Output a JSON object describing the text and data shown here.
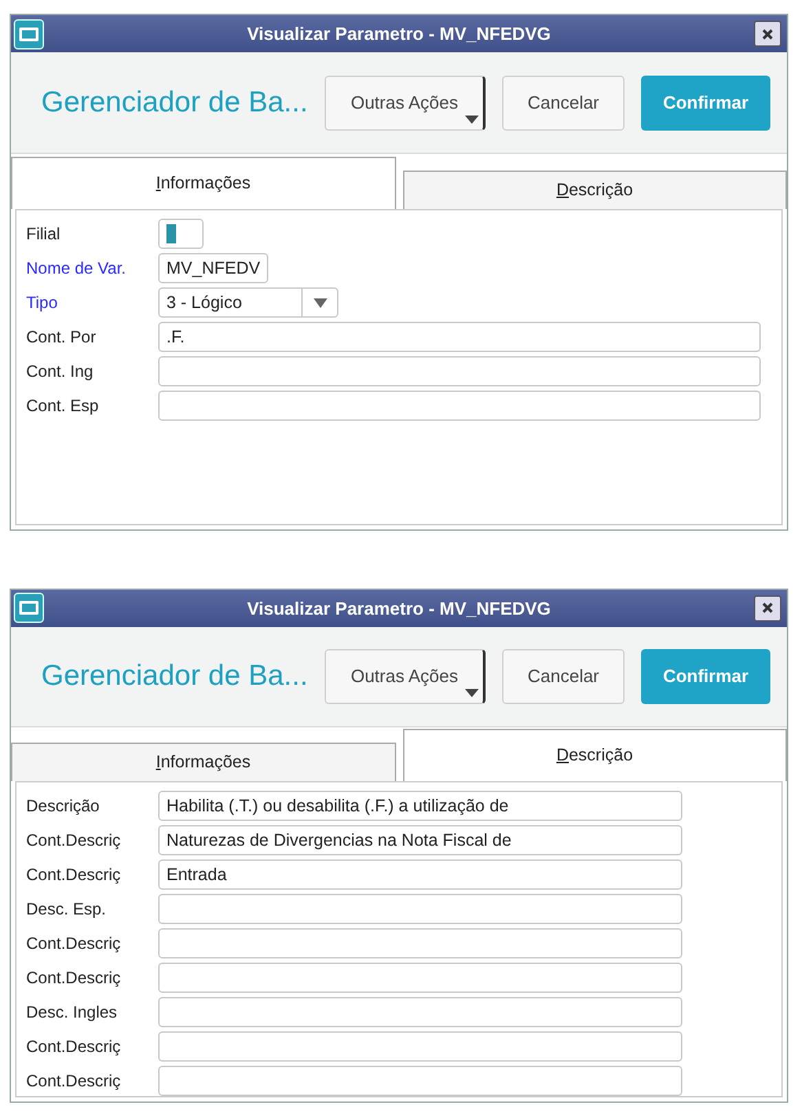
{
  "windows": [
    {
      "title": "Visualizar Parametro - MV_NFEDVG",
      "heading": "Gerenciador de Ba...",
      "buttons": [
        {
          "label": "Outras Ações",
          "kind": "menu"
        },
        {
          "label": "Cancelar",
          "kind": "default"
        },
        {
          "label": "Confirmar",
          "kind": "primary"
        }
      ],
      "tabs": [
        {
          "label": "Informações",
          "selected": true
        },
        {
          "label": "Descrição",
          "selected": false
        }
      ],
      "fields": [
        {
          "label": "Filial",
          "required": false,
          "kind": "swatch"
        },
        {
          "label": "Nome de Var.",
          "required": true,
          "kind": "short",
          "value": "MV_NFEDV"
        },
        {
          "label": "Tipo",
          "required": true,
          "kind": "select",
          "value": "3 - Lógico"
        },
        {
          "label": "Cont. Por",
          "required": false,
          "kind": "text",
          "value": ".F."
        },
        {
          "label": "Cont. Ing",
          "required": false,
          "kind": "text"
        },
        {
          "label": "Cont. Esp",
          "required": false,
          "kind": "text"
        }
      ]
    },
    {
      "title": "Visualizar Parametro - MV_NFEDVG",
      "heading": "Gerenciador de Ba...",
      "buttons": [
        {
          "label": "Outras Ações",
          "kind": "menu"
        },
        {
          "label": "Cancelar",
          "kind": "default"
        },
        {
          "label": "Confirmar",
          "kind": "primary"
        }
      ],
      "tabs": [
        {
          "label": "Informações",
          "selected": false
        },
        {
          "label": "Descrição",
          "selected": true
        }
      ],
      "fields": [
        {
          "label": "Descrição",
          "required": false,
          "kind": "text",
          "value": "Habilita (.T.) ou desabilita (.F.) a utilização de"
        },
        {
          "label": "Cont.Descriç",
          "required": false,
          "kind": "text",
          "value": "Naturezas de Divergencias na Nota Fiscal de"
        },
        {
          "label": "Cont.Descriç",
          "required": false,
          "kind": "text",
          "value": "Entrada"
        },
        {
          "label": "Desc. Esp.",
          "required": false,
          "kind": "text"
        },
        {
          "label": "Cont.Descriç",
          "required": false,
          "kind": "text"
        },
        {
          "label": "Cont.Descriç",
          "required": false,
          "kind": "text"
        },
        {
          "label": "Desc. Ingles",
          "required": false,
          "kind": "text"
        },
        {
          "label": "Cont.Descriç",
          "required": false,
          "kind": "text"
        },
        {
          "label": "Cont.Descriç",
          "required": false,
          "kind": "text"
        }
      ]
    }
  ]
}
